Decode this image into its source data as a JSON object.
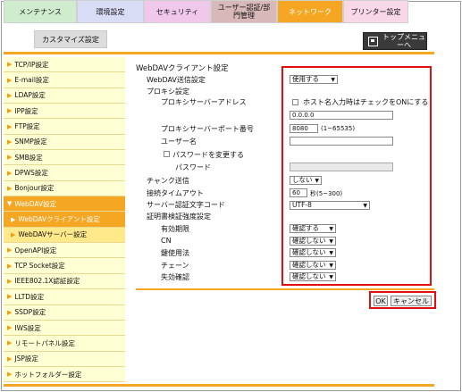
{
  "tabs": [
    {
      "label": "メンテナンス",
      "bg": "#cfeccf"
    },
    {
      "label": "環境設定",
      "bg": "#d9dcf5"
    },
    {
      "label": "セキュリティ",
      "bg": "#f0c8ec"
    },
    {
      "label": "ユーザー認証/部門管理",
      "bg": "#d8b8b8"
    },
    {
      "label": "ネットワーク",
      "bg": "#f5a623"
    },
    {
      "label": "プリンター設定",
      "bg": "#f8d7e6"
    }
  ],
  "subtab": "カスタマイズ設定",
  "top_menu": "トップメニューへ",
  "sidebar": [
    {
      "label": "TCP/IP設定"
    },
    {
      "label": "E-mail設定"
    },
    {
      "label": "LDAP設定"
    },
    {
      "label": "IPP設定"
    },
    {
      "label": "FTP設定"
    },
    {
      "label": "SNMP設定"
    },
    {
      "label": "SMB設定"
    },
    {
      "label": "DPWS設定"
    },
    {
      "label": "Bonjour設定"
    },
    {
      "label": "WebDAV設定"
    },
    {
      "label": "WebDAVクライアント設定"
    },
    {
      "label": "WebDAVサーバー設定"
    },
    {
      "label": "OpenAPI設定"
    },
    {
      "label": "TCP Socket設定"
    },
    {
      "label": "IEEE802.1X認証設定"
    },
    {
      "label": "LLTD設定"
    },
    {
      "label": "SSDP設定"
    },
    {
      "label": "IWS設定"
    },
    {
      "label": "リモートパネル設定"
    },
    {
      "label": "JSP設定"
    },
    {
      "label": "ホットフォルダー設定"
    }
  ],
  "form": {
    "title": "WebDAVクライアント設定",
    "send_label": "WebDAV送信設定",
    "send_value": "使用する",
    "proxy_label": "プロキシ設定",
    "proxy_addr_label": "プロキシサーバーアドレス",
    "host_check_label": "ホスト名入力時はチェックをONにする",
    "proxy_addr_value": "0.0.0.0",
    "proxy_port_label": "プロキシサーバーポート番号",
    "proxy_port_value": "8080",
    "proxy_port_range": "(1~65535)",
    "user_label": "ユーザー名",
    "change_pw_label": "パスワードを変更する",
    "password_label": "パスワード",
    "chunk_label": "チャンク送信",
    "chunk_value": "しない",
    "timeout_label": "接続タイムアウト",
    "timeout_value": "60",
    "timeout_unit": "秒(5~300)",
    "charset_label": "サーバー認証文字コード",
    "charset_value": "UTF-8",
    "cert_label": "証明書検証強度設定",
    "validity_label": "有効期限",
    "validity_value": "確認する",
    "cn_label": "CN",
    "cn_value": "確認しない",
    "usage_label": "鍵使用法",
    "usage_value": "確認しない",
    "chain_label": "チェーン",
    "chain_value": "確認しない",
    "revoke_label": "失効確認",
    "revoke_value": "確認しない"
  },
  "ok": "OK",
  "cancel": "キャンセル"
}
